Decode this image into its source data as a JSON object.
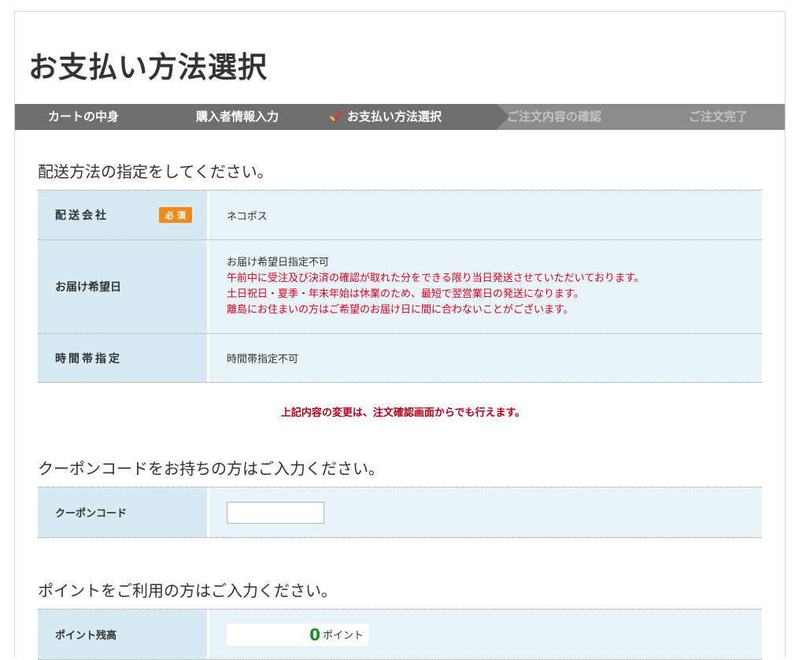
{
  "page": {
    "title": "お支払い方法選択"
  },
  "steps": [
    {
      "label": "カートの中身",
      "state": "done"
    },
    {
      "label": "購入者情報入力",
      "state": "done"
    },
    {
      "label": "お支払い方法選択",
      "state": "current"
    },
    {
      "label": "ご注文内容の確認",
      "state": "todo"
    },
    {
      "label": "ご注文完了",
      "state": "todo"
    }
  ],
  "delivery": {
    "heading": "配送方法の指定をしてください。",
    "company_label": "配送会社",
    "required_badge": "必 須",
    "company_value": "ネコポス",
    "date_label": "お届け希望日",
    "date_note_main": "お届け希望日指定不可",
    "date_notes_red": [
      "午前中に受注及び決済の確認が取れた分をできる限り当日発送させていただいております。",
      "土日祝日・夏季・年末年始は休業のため、最短で翌営業日の発送になります。",
      "離島にお住まいの方はご希望のお届け日に間に合わないことがございます。"
    ],
    "time_label": "時間帯指定",
    "time_value": "時間帯指定不可",
    "change_notice": "上記内容の変更は、注文確認画面からでも行えます。"
  },
  "coupon": {
    "heading": "クーポンコードをお持ちの方はご入力ください。",
    "label": "クーポンコード",
    "value": ""
  },
  "points": {
    "heading": "ポイントをご利用の方はご入力ください。",
    "balance_label": "ポイント残高",
    "balance_value": "0",
    "unit": "ポイント"
  },
  "colors": {
    "step_bar": "#6f6f6f",
    "row_label_bg": "#d6eaf1",
    "row_value_bg": "#e9f4f8",
    "required_badge": "#f08a1c",
    "notice_red": "#e0001c",
    "point_green": "#1a8f1a"
  },
  "icons": {
    "current_step": "check-icon"
  }
}
